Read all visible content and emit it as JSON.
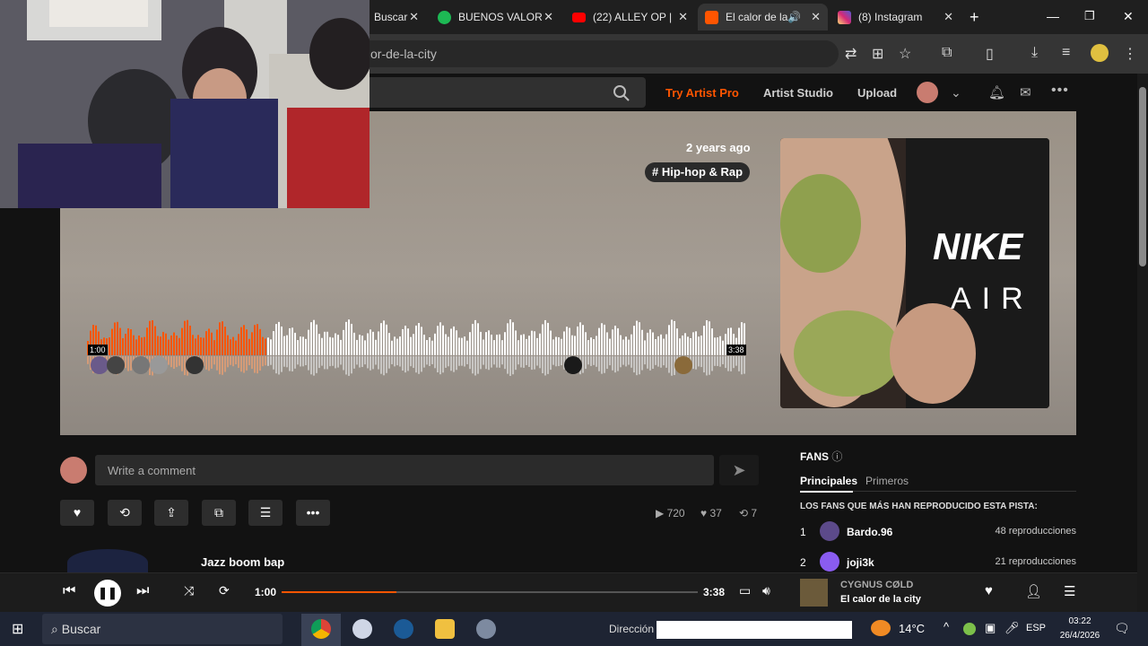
{
  "browser": {
    "tabs": [
      {
        "label": "Buscar",
        "favicon_color": "#ffffff"
      },
      {
        "label": "BUENOS VALOR",
        "favicon_color": "#1db954"
      },
      {
        "label": "(22) ALLEY OP |",
        "favicon_color": "#ff0000"
      },
      {
        "label": "El calor de la",
        "favicon_color": "#ff5500",
        "active": true
      },
      {
        "label": "(8) Instagram",
        "favicon_color": "#d6249f"
      }
    ],
    "new_tab": "+",
    "url": "or-de-la-city"
  },
  "header": {
    "try_pro": "Try Artist Pro",
    "artist_studio": "Artist Studio",
    "upload": "Upload",
    "accent": "#ff5500"
  },
  "track": {
    "posted": "2 years ago",
    "tag": "# Hip-hop & Rap",
    "elapsed": "1:00",
    "duration": "3:38",
    "progress": 0.275
  },
  "comment": {
    "placeholder": "Write a comment"
  },
  "stats": {
    "plays": "720",
    "likes": "37",
    "reposts": "7"
  },
  "fans": {
    "title": "FANS",
    "tabs": [
      "Principales",
      "Primeros"
    ],
    "subtitle": "LOS FANS QUE MÁS HAN REPRODUCIDO ESTA PISTA:",
    "rows": [
      {
        "rank": "1",
        "name": "Bardo.96",
        "plays": "48 reproducciones",
        "color": "#5c4a8a"
      },
      {
        "rank": "2",
        "name": "joji3k",
        "plays": "21 reproducciones",
        "color": "#8a5cf0"
      }
    ]
  },
  "related": {
    "title": "Jazz boom bap"
  },
  "player": {
    "elapsed": "1:00",
    "duration": "3:38",
    "progress": 0.275,
    "artist": "CYGNUS CØLD",
    "title": "El calor de la city"
  },
  "taskbar": {
    "search": "Buscar",
    "address_label": "Dirección",
    "temperature": "14°C",
    "language": "ESP",
    "time": "03:22",
    "date": "26/4/2026"
  }
}
